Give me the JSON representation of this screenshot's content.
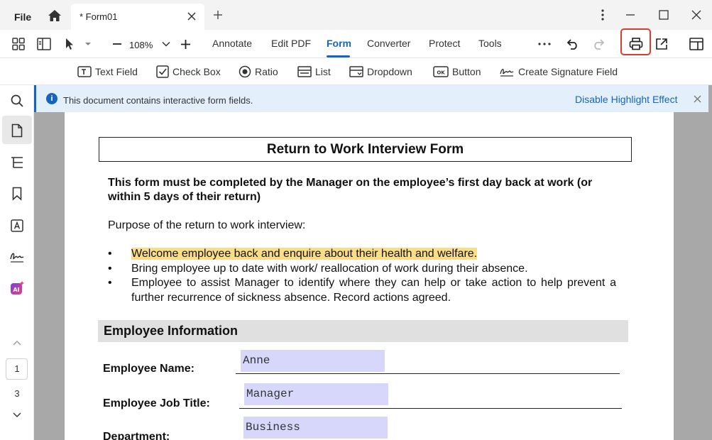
{
  "titlebar": {
    "file_menu": "File",
    "tab_title": "* Form01"
  },
  "toolbar": {
    "zoom": "108%",
    "menu": [
      "Annotate",
      "Edit PDF",
      "Form",
      "Converter",
      "Protect",
      "Tools"
    ],
    "active_menu": "Form"
  },
  "formbar": {
    "items": [
      "Text Field",
      "Check Box",
      "Ratio",
      "List",
      "Dropdown",
      "Button",
      "Create Signature Field"
    ]
  },
  "sidebar": {
    "pages": [
      "1",
      "3"
    ]
  },
  "infobar": {
    "message": "This document contains interactive form fields.",
    "action": "Disable Highlight Effect"
  },
  "document": {
    "title": "Return to Work Interview Form",
    "intro": "This form must be completed by the Manager on the employee’s first day back at work (or within 5 days of their return)",
    "purpose": "Purpose of the return to work interview:",
    "bullets": [
      "Welcome employee back and enquire about their health and welfare.",
      "Bring employee up to date with work/ reallocation of work during their absence.",
      "Employee to assist Manager to identify where they can help or take action to help prevent a further recurrence of sickness absence. Record actions agreed."
    ],
    "section": "Employee Information",
    "fields": [
      {
        "label": "Employee Name:",
        "value": "Anne"
      },
      {
        "label": "Employee Job Title:",
        "value": "Manager"
      },
      {
        "label": "Department:",
        "value": "Business"
      }
    ]
  },
  "colors": {
    "accent": "#1565c0",
    "highlight": "#fbdc87",
    "form_field": "#d7d7fc",
    "print_outline": "#e03a2f"
  }
}
